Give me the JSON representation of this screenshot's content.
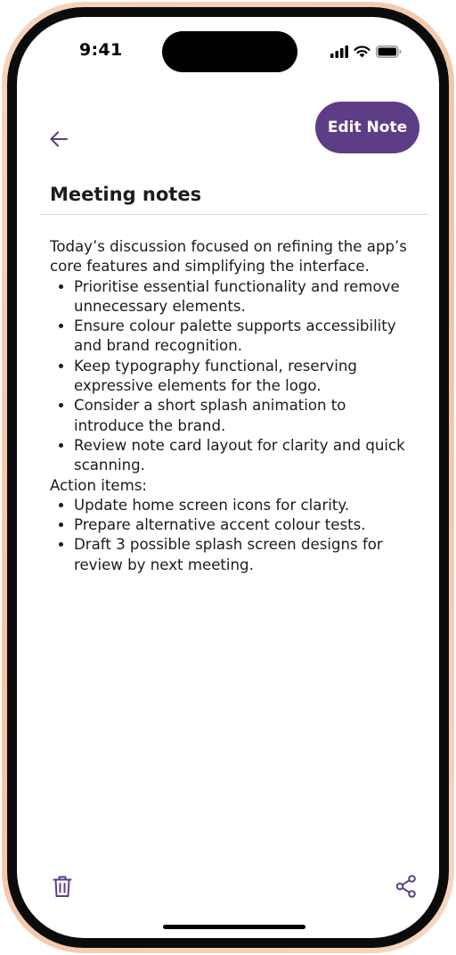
{
  "status_bar": {
    "time": "9:41",
    "icons": [
      "cellular-signal-icon",
      "wifi-icon",
      "battery-icon"
    ]
  },
  "toolbar": {
    "back_icon": "arrow-left-icon",
    "edit_label": "Edit Note"
  },
  "note": {
    "title": "Meeting notes",
    "intro": "Today’s discussion focused on refining the app’s core features and simplifying the interface.",
    "points": [
      "Prioritise essential functionality and remove unnecessary elements.",
      "Ensure colour palette supports accessibility and brand recognition.",
      "Keep typography functional, reserving expressive elements for the logo.",
      "Consider a short splash animation to introduce the brand.",
      "Review note card layout for clarity and quick scanning."
    ],
    "action_heading": "Action items:",
    "actions": [
      "Update home screen icons for clarity.",
      "Prepare alternative accent colour tests.",
      "Draft 3 possible splash screen designs for review by next meeting."
    ]
  },
  "bottom_bar": {
    "delete_icon": "trash-icon",
    "share_icon": "share-icon"
  },
  "colors": {
    "accent": "#5e3d87",
    "frame": "#f2c3a4",
    "text": "#1c1b1f"
  }
}
